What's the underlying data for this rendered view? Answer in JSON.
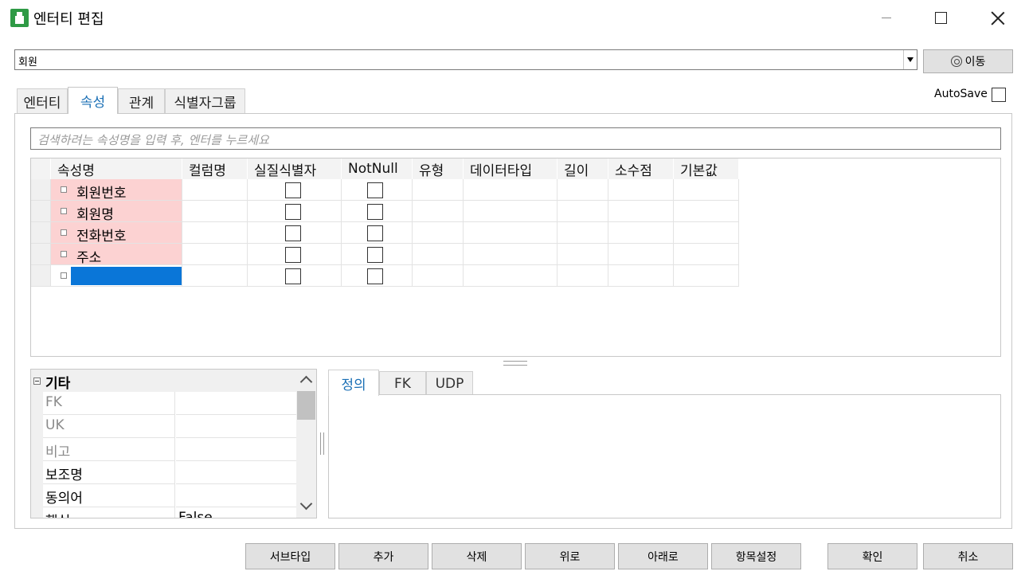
{
  "window": {
    "title": "엔터티 편집",
    "minimize_icon": "minimize-icon",
    "maximize_icon": "maximize-icon",
    "close_icon": "close-icon"
  },
  "entity_selector": {
    "value": "회원",
    "move_label": "이동"
  },
  "autosave": {
    "label": "AutoSave",
    "checked": false
  },
  "tabs": [
    {
      "label": "엔터티",
      "active": false
    },
    {
      "label": "속성",
      "active": true
    },
    {
      "label": "관계",
      "active": false
    },
    {
      "label": "식별자그룹",
      "active": false
    }
  ],
  "search": {
    "placeholder": "검색하려는 속성명을 입력 후, 엔터를 누르세요"
  },
  "grid": {
    "columns": [
      "속성명",
      "컬럼명",
      "실질식별자",
      "NotNull",
      "유형",
      "데이터타입",
      "길이",
      "소수점",
      "기본값"
    ],
    "rows": [
      {
        "name": "회원번호",
        "column": "",
        "real_identifier": false,
        "not_null": false
      },
      {
        "name": "회원명",
        "column": "",
        "real_identifier": false,
        "not_null": false
      },
      {
        "name": "전화번호",
        "column": "",
        "real_identifier": false,
        "not_null": false
      },
      {
        "name": "주소",
        "column": "",
        "real_identifier": false,
        "not_null": false
      },
      {
        "name": "",
        "column": "",
        "real_identifier": false,
        "not_null": false
      }
    ],
    "identifier_row_color": "#fcd2d2",
    "selection_color": "#0a76d8"
  },
  "properties": {
    "category": "기타",
    "rows": [
      {
        "name": "FK",
        "value": "",
        "readonly": true
      },
      {
        "name": "UK",
        "value": "",
        "readonly": true
      },
      {
        "name": "비고",
        "value": "",
        "readonly": true
      },
      {
        "name": "보조명",
        "value": "",
        "readonly": false
      },
      {
        "name": "동의어",
        "value": "",
        "readonly": false
      },
      {
        "name": "핵심",
        "value": "False",
        "readonly": false
      }
    ]
  },
  "detail_tabs": [
    {
      "label": "정의",
      "active": true
    },
    {
      "label": "FK",
      "active": false
    },
    {
      "label": "UDP",
      "active": false
    }
  ],
  "buttons": {
    "subtype": "서브타입",
    "add": "추가",
    "delete": "삭제",
    "up": "위로",
    "down": "아래로",
    "item_settings": "항목설정",
    "ok": "확인",
    "cancel": "취소"
  },
  "colors": {
    "accent": "#1a6fb5",
    "app_icon": "#2e9a45"
  }
}
